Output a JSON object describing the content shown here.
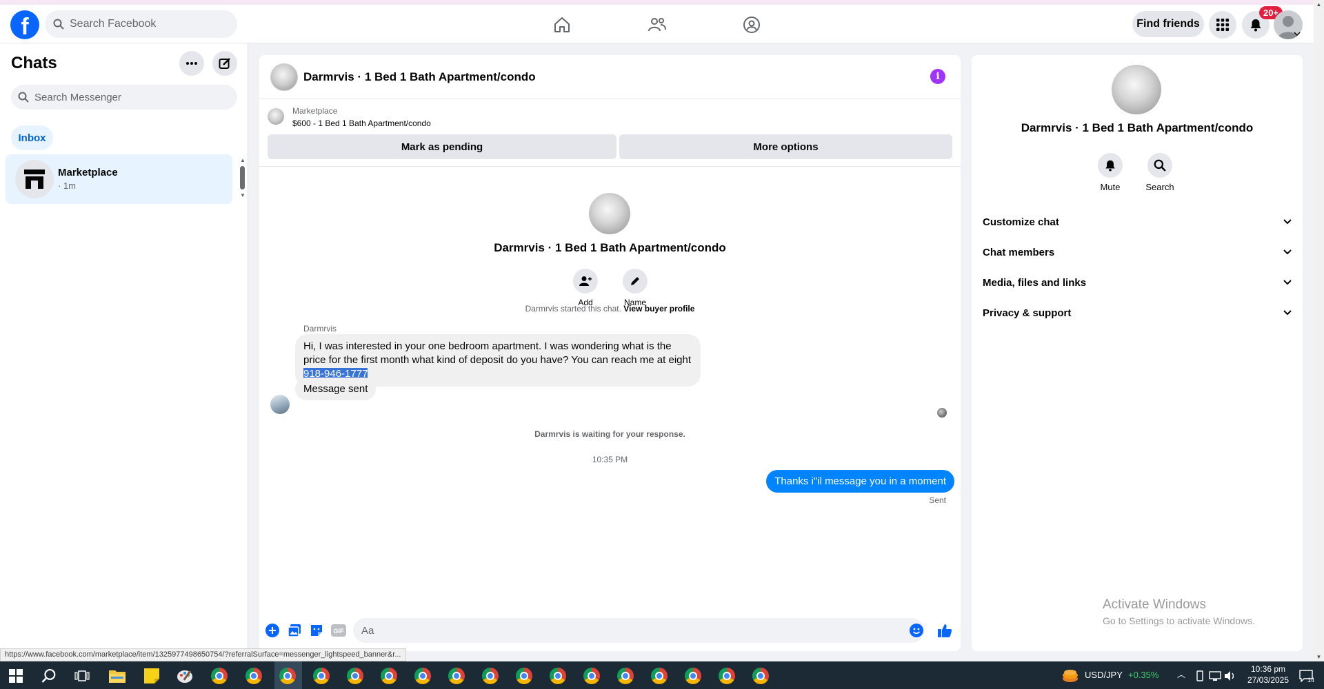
{
  "topbar": {
    "search_placeholder": "Search Facebook",
    "find_friends": "Find friends",
    "notifications_badge": "20+"
  },
  "left": {
    "title": "Chats",
    "search_placeholder": "Search Messenger",
    "inbox_label": "Inbox",
    "chat_items": [
      {
        "name": "Marketplace",
        "time": "· 1m"
      }
    ]
  },
  "conversation": {
    "title": "Darmrvis · 1 Bed 1 Bath Apartment/condo",
    "marketplace_label": "Marketplace",
    "listing": "$600 - 1 Bed 1 Bath Apartment/condo",
    "mark_pending": "Mark as pending",
    "more_options": "More options",
    "center_title": "Darmrvis · 1 Bed 1 Bath Apartment/condo",
    "add_label": "Add",
    "name_label": "Name",
    "started_text": "Darmrvis started this chat.",
    "view_profile": "View buyer profile",
    "sender": "Darmrvis",
    "message_text": "Hi, I was interested in your one bedroom apartment. I was wondering what is the price for the first month what kind of deposit do you have? You can reach me at eight ",
    "phone_highlight": "918-946-1777",
    "message_sent": "Message sent",
    "waiting_text": "Darmrvis is waiting for your response.",
    "timestamp": "10:35 PM",
    "outgoing": "Thanks i\"il message you in a moment",
    "sent_label": "Sent",
    "composer_placeholder": "Aa"
  },
  "right": {
    "title": "Darmrvis · 1 Bed 1 Bath Apartment/condo",
    "mute_label": "Mute",
    "search_label": "Search",
    "sections": [
      "Customize chat",
      "Chat members",
      "Media, files and links",
      "Privacy & support"
    ],
    "activate_title": "Activate Windows",
    "activate_sub": "Go to Settings to activate Windows."
  },
  "status_url": "https://www.facebook.com/marketplace/item/1325977498650754/?referralSurface=messenger_lightspeed_banner&r...",
  "taskbar": {
    "ticker_name": "USD/JPY",
    "ticker_change": "+0.35%",
    "time": "10:36 pm",
    "date": "27/03/2025",
    "notification_count": "14"
  },
  "colors": {
    "facebook_blue": "#0866ff",
    "messenger_blue": "#0084ff",
    "highlight": "#3874d8",
    "info_purple": "#a033ff",
    "badge_red": "#e41e3f"
  }
}
